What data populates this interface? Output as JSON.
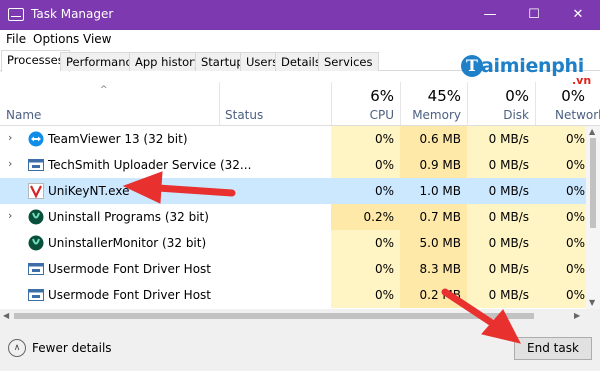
{
  "window": {
    "title": "Task Manager",
    "minimize": "—",
    "maximize": "☐",
    "close": "✕"
  },
  "menu": [
    "File",
    "Options",
    "View"
  ],
  "tabs": [
    "Processes",
    "Performance",
    "App history",
    "Startup",
    "Users",
    "Details",
    "Services"
  ],
  "watermark": {
    "mark": "T",
    "text": "aimienphi",
    "suffix": ".vn"
  },
  "columns": {
    "name": "Name",
    "status": "Status",
    "cpu": {
      "label": "CPU",
      "total": "6%"
    },
    "memory": {
      "label": "Memory",
      "total": "45%"
    },
    "disk": {
      "label": "Disk",
      "total": "0%"
    },
    "network": {
      "label": "Network",
      "total": "0%"
    }
  },
  "processes": [
    {
      "expand": "›",
      "icon": "teamviewer-icon",
      "name": "TeamViewer 13 (32 bit)",
      "cpu": "0%",
      "memory": "0.6 MB",
      "disk": "0 MB/s",
      "network": "0%"
    },
    {
      "expand": "›",
      "icon": "service-window-icon",
      "name": "TechSmith Uploader Service (32...",
      "cpu": "0%",
      "memory": "0.9 MB",
      "disk": "0 MB/s",
      "network": "0%"
    },
    {
      "expand": "",
      "icon": "unikey-icon",
      "name": "UniKeyNT.exe",
      "cpu": "0%",
      "memory": "1.0 MB",
      "disk": "0 MB/s",
      "network": "0%",
      "selected": true
    },
    {
      "expand": "›",
      "icon": "uninstall-icon",
      "name": "Uninstall Programs (32 bit)",
      "cpu": "0.2%",
      "memory": "0.7 MB",
      "disk": "0 MB/s",
      "network": "0%"
    },
    {
      "expand": "",
      "icon": "uninstall-icon",
      "name": "UninstallerMonitor (32 bit)",
      "cpu": "0%",
      "memory": "5.0 MB",
      "disk": "0 MB/s",
      "network": "0%"
    },
    {
      "expand": "",
      "icon": "service-window-icon",
      "name": "Usermode Font Driver Host",
      "cpu": "0%",
      "memory": "8.3 MB",
      "disk": "0 MB/s",
      "network": "0%"
    },
    {
      "expand": "",
      "icon": "service-window-icon",
      "name": "Usermode Font Driver Host",
      "cpu": "0%",
      "memory": "0.2 MB",
      "disk": "0 MB/s",
      "network": "0%"
    }
  ],
  "footer": {
    "fewer_details": "Fewer details",
    "end_task": "End task"
  },
  "colors": {
    "titlebar": "#7d39b0",
    "selected_row": "#cce8ff",
    "heat_light": "#fff4c4",
    "heat_mid": "#ffe9a9",
    "annotation_arrow": "#e8312f"
  }
}
